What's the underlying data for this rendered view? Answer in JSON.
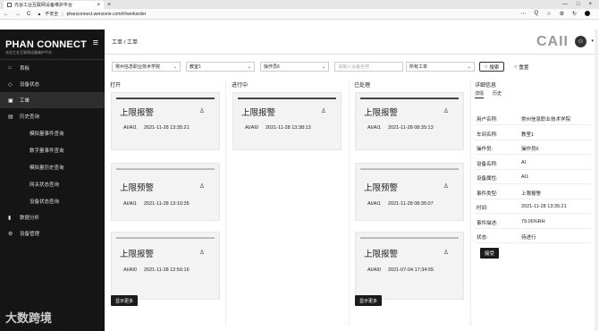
{
  "browser": {
    "tab_title": "光谷工业互联网设备维护平台",
    "tab_close": "×",
    "new_tab": "+",
    "window_controls": [
      "—",
      "□",
      "×"
    ],
    "nav": [
      "←",
      "→",
      "C"
    ],
    "security": "不安全",
    "url": "phanconnect.wenzone.com/#/workorder",
    "tools": [
      "⋯",
      "Q",
      "☆",
      "⚙",
      "↻"
    ]
  },
  "sidebar": {
    "logo": "PHAN CONNECT",
    "logo_sub": "光谷工业互联网设备维护平台",
    "menu_icon": "≡",
    "items": [
      {
        "icon": "⌂",
        "label": "首板"
      },
      {
        "icon": "◇",
        "label": "设备状态"
      },
      {
        "icon": "▣",
        "label": "工单",
        "active": true
      },
      {
        "icon": "▤",
        "label": "历史查询"
      },
      {
        "label": "模拟量事件查询",
        "sub": true
      },
      {
        "label": "数字量事件查询",
        "sub": true
      },
      {
        "label": "模拟量历史查询",
        "sub": true
      },
      {
        "label": "网关状态查询",
        "sub": true
      },
      {
        "label": "设备状态查询",
        "sub": true
      },
      {
        "icon": "▮",
        "label": "数据分析"
      },
      {
        "icon": "⚙",
        "label": "设备管理"
      }
    ],
    "watermark": "大数跨境"
  },
  "header": {
    "breadcrumb": "工单 / 工单",
    "brand": "CAII",
    "avatar": "☺",
    "caret": "▾"
  },
  "filters": {
    "school": "常州信息职业技术学院",
    "room": "教室1",
    "operator": "操作员6",
    "device_placeholder": "请输入设备名称",
    "type": "所有工单",
    "arrow": "⌄",
    "search_label": "搜索",
    "reset_label": "重置"
  },
  "columns": [
    {
      "title": "打开",
      "cards": [
        {
          "title": "上限报警",
          "device": "AI/AI1",
          "time": "2021-11-28 13:35:21",
          "bar": "dark"
        },
        {
          "title": "上限预警",
          "device": "AI/AI1",
          "time": "2021-11-28 13:10:35",
          "bar": "light"
        },
        {
          "title": "上限报警",
          "device": "AI/AI0",
          "time": "2021-11-28 12:50:16",
          "bar": "light"
        }
      ],
      "more": "显示更多"
    },
    {
      "title": "进行中",
      "cards": [
        {
          "title": "上限报警",
          "device": "AI/AI0",
          "time": "2021-11-28 13:38:13",
          "bar": "dark"
        }
      ]
    },
    {
      "title": "已处理",
      "cards": [
        {
          "title": "上限报警",
          "device": "AI/AI1",
          "time": "2021-11-28 08:35:13",
          "bar": "dark"
        },
        {
          "title": "上限预警",
          "device": "AI/AI1",
          "time": "2021-11-28 08:35:07",
          "bar": "light"
        },
        {
          "title": "上限报警",
          "device": "AI/AI0",
          "time": "2021-07-04 17:34:55",
          "bar": "light"
        }
      ],
      "more": "显示更多"
    }
  ],
  "user_icon": "♙",
  "detail": {
    "title": "详细信息",
    "tabs": [
      "详情",
      "历史"
    ],
    "rows": [
      {
        "k": "用户名称:",
        "v": "常州信息职业技术学院"
      },
      {
        "k": "车间名称:",
        "v": "教室1"
      },
      {
        "k": "操作员:",
        "v": "操作员6"
      },
      {
        "k": "设备名称:",
        "v": "AI"
      },
      {
        "k": "设备属性:",
        "v": "AI1"
      },
      {
        "k": "事件类型:",
        "v": "上限报警"
      },
      {
        "k": "时间:",
        "v": "2021-11-28 13:35:21"
      },
      {
        "k": "事件描述:",
        "v": "79.06%RH"
      },
      {
        "k": "状态:",
        "v": "待进行"
      }
    ],
    "receive_label": "接受"
  }
}
